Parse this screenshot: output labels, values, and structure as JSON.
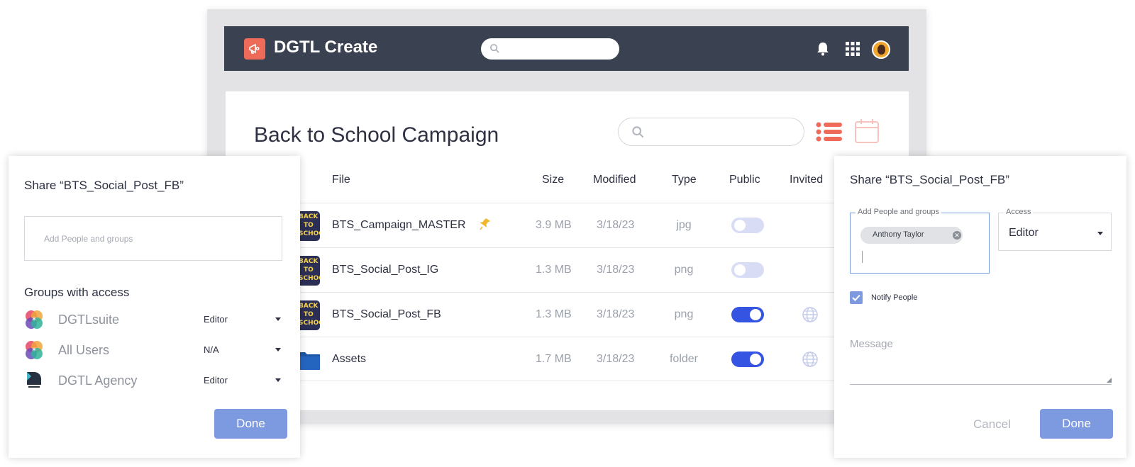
{
  "app": {
    "title": "DGTL Create"
  },
  "page": {
    "title": "Back to School Campaign"
  },
  "table": {
    "columns": {
      "file": "File",
      "size": "Size",
      "modified": "Modified",
      "type": "Type",
      "public": "Public",
      "invited": "Invited"
    },
    "rows": [
      {
        "name": "BTS_Campaign_MASTER",
        "size": "3.9 MB",
        "modified": "3/18/23",
        "type": "jpg",
        "public": false,
        "pinned": true,
        "thumb": "thumbnail",
        "thumb_text": [
          "BACK",
          "TO",
          "SCHOOL"
        ]
      },
      {
        "name": "BTS_Social_Post_IG",
        "size": "1.3 MB",
        "modified": "3/18/23",
        "type": "png",
        "public": false,
        "pinned": false,
        "thumb": "thumbnail",
        "thumb_text": [
          "BACK",
          "TO",
          "SCHOOL"
        ]
      },
      {
        "name": "BTS_Social_Post_FB",
        "size": "1.3 MB",
        "modified": "3/18/23",
        "type": "png",
        "public": true,
        "pinned": false,
        "thumb": "thumbnail",
        "thumb_text": [
          "BACK",
          "TO",
          "SCHOOL"
        ]
      },
      {
        "name": "Assets",
        "size": "1.7 MB",
        "modified": "3/18/23",
        "type": "folder",
        "public": true,
        "pinned": false,
        "thumb": "folder-icon",
        "thumb_text": []
      }
    ]
  },
  "share_left": {
    "title": "Share “BTS_Social_Post_FB”",
    "people_placeholder": "Add People and groups",
    "groups_heading": "Groups with access",
    "groups": [
      {
        "name": "DGTLsuite",
        "role": "Editor",
        "icon": "dgtlsuite-logo"
      },
      {
        "name": "All Users",
        "role": "N/A",
        "icon": "dgtlsuite-logo"
      },
      {
        "name": "DGTL Agency",
        "role": "Editor",
        "icon": "dgtl-agency-logo"
      }
    ],
    "done_label": "Done"
  },
  "share_right": {
    "title": "Share “BTS_Social_Post_FB”",
    "people_legend": "Add People and groups",
    "chip_name": "Anthony Taylor",
    "access_legend": "Access",
    "access_value": "Editor",
    "notify_label": "Notify People",
    "notify_checked": true,
    "message_placeholder": "Message",
    "cancel_label": "Cancel",
    "done_label": "Done"
  },
  "colors": {
    "topbar": "#3a4150",
    "accent": "#ee6b59",
    "toggle_on": "#3554e2",
    "toggle_off": "#d9dcf5",
    "primary_button": "#7d9ae0"
  }
}
